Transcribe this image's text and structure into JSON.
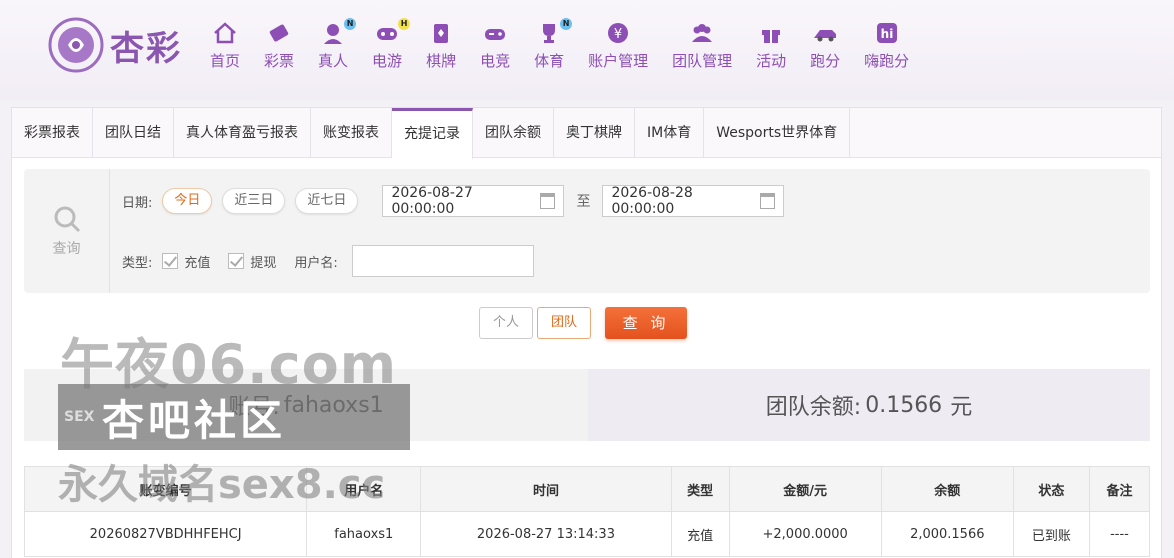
{
  "brand": {
    "name": "杏彩",
    "accent": "#8a56b0"
  },
  "nav": [
    {
      "label": "首页",
      "icon": "home-icon",
      "badge": ""
    },
    {
      "label": "彩票",
      "icon": "lottery-ticket-icon",
      "badge": ""
    },
    {
      "label": "真人",
      "icon": "live-dealer-icon",
      "badge": "N"
    },
    {
      "label": "电游",
      "icon": "gamepad-icon",
      "badge": "H"
    },
    {
      "label": "棋牌",
      "icon": "cards-icon",
      "badge": ""
    },
    {
      "label": "电竞",
      "icon": "controller-icon",
      "badge": ""
    },
    {
      "label": "体育",
      "icon": "trophy-icon",
      "badge": "N"
    },
    {
      "label": "账户管理",
      "icon": "yen-icon",
      "badge": ""
    },
    {
      "label": "团队管理",
      "icon": "team-icon",
      "badge": ""
    },
    {
      "label": "活动",
      "icon": "gift-icon",
      "badge": ""
    },
    {
      "label": "跑分",
      "icon": "running-car-icon",
      "badge": ""
    },
    {
      "label": "嗨跑分",
      "icon": "hi-app-icon",
      "badge": ""
    }
  ],
  "tabs": [
    "彩票报表",
    "团队日结",
    "真人体育盈亏报表",
    "账变报表",
    "充提记录",
    "团队余额",
    "奥丁棋牌",
    "IM体育",
    "Wesports世界体育"
  ],
  "active_tab": "充提记录",
  "filter": {
    "search_label": "查询",
    "date_label": "日期:",
    "quick_ranges": [
      "今日",
      "近三日",
      "近七日"
    ],
    "active_range": "今日",
    "start_date": "2026-08-27 00:00:00",
    "to_label": "至",
    "end_date": "2026-08-28 00:00:00",
    "type_label": "类型:",
    "types": [
      "充值",
      "提现"
    ],
    "username_label": "用户名:",
    "username_value": ""
  },
  "actions": {
    "personal": "个人",
    "team": "团队",
    "query": "查 询"
  },
  "summary": {
    "account_label": "账号:",
    "account": "fahaoxs1",
    "balance_label": "团队余额:",
    "balance": "0.1566",
    "unit": "元"
  },
  "table": {
    "headers": [
      "账变编号",
      "用户名",
      "时间",
      "类型",
      "金额/元",
      "余额",
      "状态",
      "备注"
    ],
    "rows": [
      [
        "20260827VBDHHFEHCJ",
        "fahaoxs1",
        "2026-08-27 13:14:33",
        "充值",
        "+2,000.0000",
        "2,000.1566",
        "已到账",
        "----"
      ]
    ]
  },
  "watermark": {
    "line1": "午夜06.com",
    "badge": "SEX",
    "line2": "杏吧社区",
    "line3": "永久域名sex8.cc"
  }
}
